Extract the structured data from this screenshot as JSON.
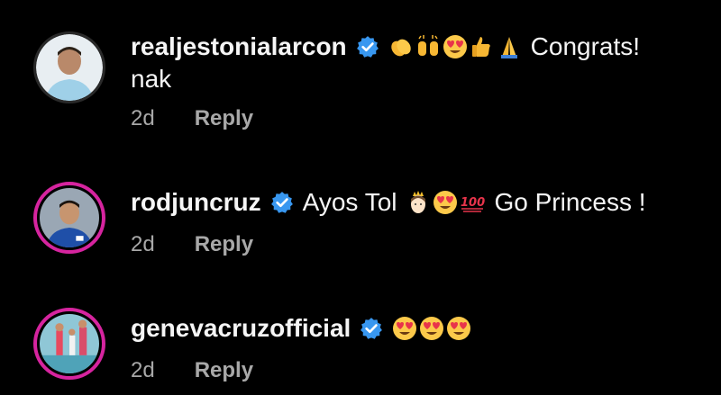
{
  "comments": [
    {
      "username": "realjestonialarcon",
      "emojis": [
        "clap-hands",
        "raised-hands",
        "heart-eyes",
        "thumbs-up",
        "folded-hands"
      ],
      "text": "Congrats!",
      "text_cont": "nak",
      "time": "2d",
      "reply_label": "Reply"
    },
    {
      "username": "rodjuncruz",
      "text_before": "Ayos Tol",
      "emojis": [
        "princess-face",
        "heart-eyes",
        "hundred-points"
      ],
      "text": "Go Princess !",
      "time": "2d",
      "reply_label": "Reply"
    },
    {
      "username": "genevacruzofficial",
      "emojis": [
        "heart-eyes",
        "heart-eyes",
        "heart-eyes"
      ],
      "time": "2d",
      "reply_label": "Reply"
    }
  ],
  "colors": {
    "verified": "#3897f0",
    "story_ring": "#d6249f",
    "meta_text": "#a8a8a8"
  }
}
